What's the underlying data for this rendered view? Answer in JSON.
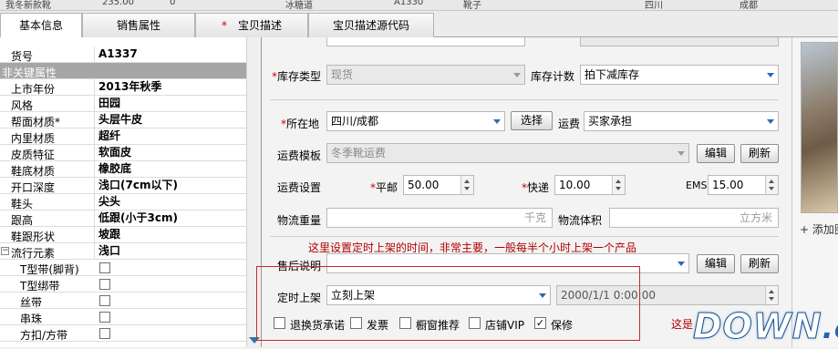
{
  "top_strip": [
    "我冬新款靴",
    "235.00",
    "0",
    "冰糖道",
    "A1330",
    "靴子",
    "四川",
    "成都"
  ],
  "tabs": [
    {
      "label": "基本信息",
      "required": false
    },
    {
      "label": "销售属性",
      "required": false
    },
    {
      "label": "宝贝描述",
      "required": true
    },
    {
      "label": "宝贝描述源代码",
      "required": false
    }
  ],
  "props": {
    "sku": {
      "key": "货号",
      "value": "A1337"
    },
    "section": "非关键属性",
    "rows": [
      {
        "key": "上市年份",
        "value": "2013年秋季"
      },
      {
        "key": "风格",
        "value": "田园"
      },
      {
        "key": "帮面材质*",
        "value": "头层牛皮"
      },
      {
        "key": "内里材质",
        "value": "超纤"
      },
      {
        "key": "皮质特征",
        "value": "软面皮"
      },
      {
        "key": "鞋底材质",
        "value": "橡胶底"
      },
      {
        "key": "开口深度",
        "value": "浅口(7cm以下)"
      },
      {
        "key": "鞋头",
        "value": "尖头"
      },
      {
        "key": "跟高",
        "value": "低跟(小于3cm)"
      },
      {
        "key": "鞋跟形状",
        "value": "坡跟"
      },
      {
        "key": "流行元素",
        "value": "浅口"
      }
    ],
    "children": [
      {
        "key": "T型带(脚背)"
      },
      {
        "key": "T型绑带"
      },
      {
        "key": "丝带"
      },
      {
        "key": "串珠"
      },
      {
        "key": "方扣/方带"
      }
    ]
  },
  "form": {
    "stock_type_label": "库存类型",
    "stock_type_value": "现货",
    "stock_count_label": "库存计数",
    "stock_count_value": "拍下减库存",
    "location_label": "所在地",
    "location_value": "四川/成都",
    "select_button": "选择",
    "shipping_label": "运费",
    "shipping_value": "买家承担",
    "template_label": "运费模板",
    "template_value": "冬季靴运费",
    "edit_button": "编辑",
    "refresh_button": "刷新",
    "freight_label": "运费设置",
    "mail_label": "平邮",
    "mail_value": "50.00",
    "express_label": "快递",
    "express_value": "10.00",
    "ems_label": "EMS",
    "ems_value": "15.00",
    "weight_label": "物流重量",
    "weight_unit": "千克",
    "volume_label": "物流体积",
    "volume_unit": "立方米",
    "annotation": "这里设置定时上架的时间，非常主要，一般每半个小时上架一个产品",
    "aftersale_label": "售后说明",
    "schedule_label": "定时上架",
    "schedule_value": "立刻上架",
    "schedule_time": "2000/1/1 0:00:00",
    "checkboxes": [
      {
        "label": "退换货承诺",
        "checked": false
      },
      {
        "label": "发票",
        "checked": false
      },
      {
        "label": "橱窗推荐",
        "checked": false
      },
      {
        "label": "店铺VIP",
        "checked": false
      },
      {
        "label": "保修",
        "checked": true
      }
    ],
    "partial_note": "这是"
  },
  "right_panel": {
    "add_image": "+ 添加图"
  },
  "watermark": {
    "text_main": "DOWN",
    "text_suffix": ".cc"
  },
  "colors": {
    "annotation": "#b00000",
    "frame": "#c62a2a",
    "section_bg": "#a6a6a6",
    "accent_arrow": "#2b6ab5"
  }
}
